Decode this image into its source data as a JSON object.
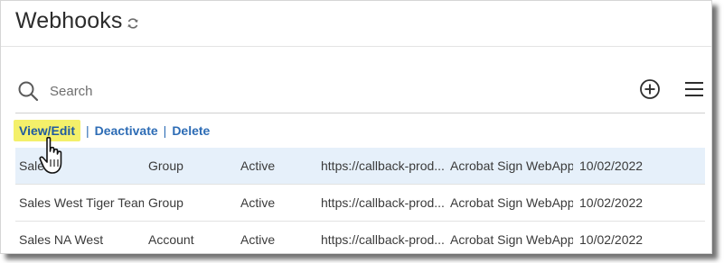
{
  "header": {
    "title": "Webhooks",
    "refresh_icon": "refresh-icon"
  },
  "search": {
    "placeholder": "Search",
    "value": ""
  },
  "toolbar": {
    "add_icon": "add-circle-icon",
    "menu_icon": "hamburger-menu-icon"
  },
  "actions": {
    "view_edit": "View/Edit",
    "separator": "|",
    "deactivate": "Deactivate",
    "delete": "Delete"
  },
  "rows": [
    {
      "name": "Sales",
      "scope": "Group",
      "status": "Active",
      "url": "https://callback-prod....",
      "application": "Acrobat Sign WebApp",
      "date": "10/02/2022"
    },
    {
      "name": "Sales West Tiger Team",
      "scope": "Group",
      "status": "Active",
      "url": "https://callback-prod....",
      "application": "Acrobat Sign WebApp",
      "date": "10/02/2022"
    },
    {
      "name": "Sales NA West",
      "scope": "Account",
      "status": "Active",
      "url": "https://callback-prod....",
      "application": "Acrobat Sign WebApp",
      "date": "10/02/2022"
    }
  ],
  "colors": {
    "link": "#2d6cb5",
    "highlight": "#f4f06a",
    "selected_row": "#e6f0fa"
  }
}
